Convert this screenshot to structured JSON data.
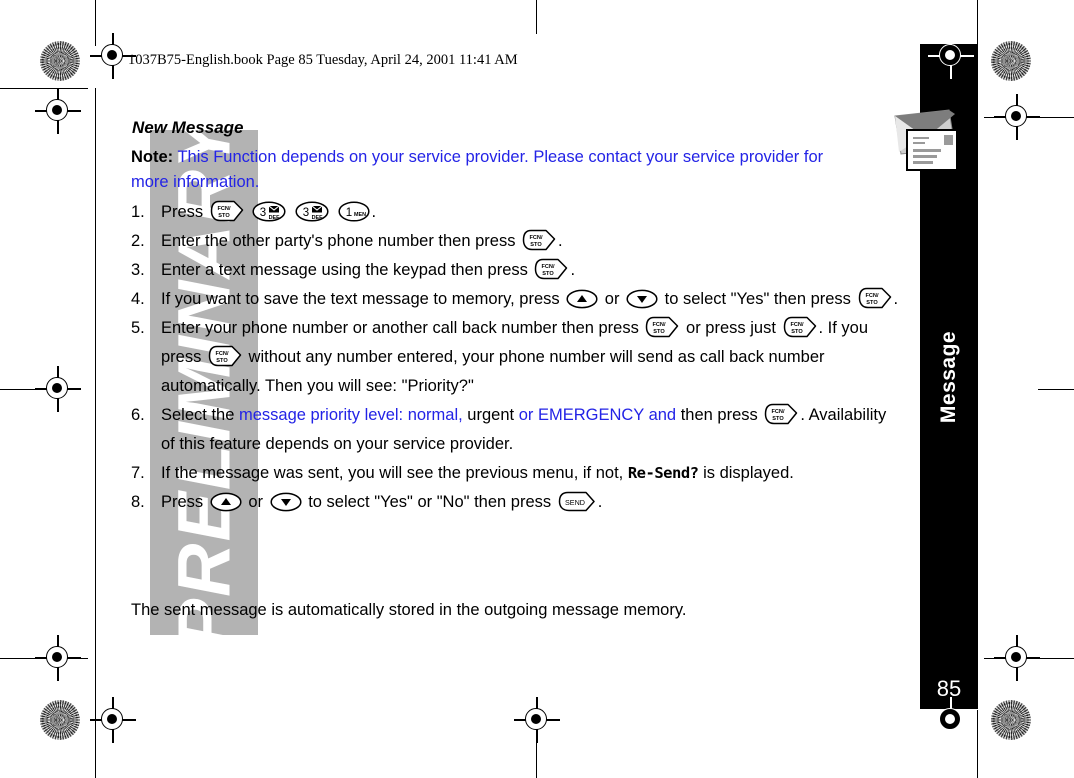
{
  "document": {
    "book_header": "1037B75-English.book  Page 85  Tuesday, April 24, 2001  11:41 AM",
    "watermark": "PRELIMINARY",
    "page_number": "85",
    "chapter_tab": "Message"
  },
  "icons": {
    "envelope": "envelope-icon",
    "fcn_sto_key": "fcn-sto-key-icon",
    "key_3def": "keypad-3-def-icon",
    "key_1men": "keypad-1-men-icon",
    "up_key": "scroll-up-key-icon",
    "down_key": "scroll-down-key-icon",
    "send_key": "send-key-icon",
    "registration_target": "registration-target-icon",
    "registration_starburst": "registration-starburst-icon"
  },
  "keys": {
    "fcn_line1": "FCN/",
    "fcn_line2": "STO",
    "three": "3",
    "def": "DEF",
    "one": "1",
    "men": "MEN",
    "send": "SEND"
  },
  "section": {
    "heading": "New Message",
    "note_label": "Note:",
    "note_text": "This Function depends on your service provider. Please contact your service provider for more information."
  },
  "steps": [
    {
      "num": "1.",
      "parts": [
        {
          "t": "Press ",
          "c": "black"
        },
        {
          "t": "[FCN/STO]",
          "c": "key-fcn"
        },
        {
          "t": " ",
          "c": "black"
        },
        {
          "t": "[3DEF]",
          "c": "key-3"
        },
        {
          "t": " ",
          "c": "black"
        },
        {
          "t": "[3DEF]",
          "c": "key-3"
        },
        {
          "t": " ",
          "c": "black"
        },
        {
          "t": "[1MEN]",
          "c": "key-1"
        },
        {
          "t": ".",
          "c": "black"
        }
      ]
    },
    {
      "num": "2.",
      "parts": [
        {
          "t": "Enter the other party's phone number then press ",
          "c": "black"
        },
        {
          "t": "[FCN/STO]",
          "c": "key-fcn"
        },
        {
          "t": ".",
          "c": "black"
        }
      ]
    },
    {
      "num": "3.",
      "parts": [
        {
          "t": "Enter a text message using the keypad then press ",
          "c": "black"
        },
        {
          "t": "[FCN/STO]",
          "c": "key-fcn"
        },
        {
          "t": ".",
          "c": "black"
        }
      ]
    },
    {
      "num": "4.",
      "parts": [
        {
          "t": "If you want to save the text message to memory, press ",
          "c": "black"
        },
        {
          "t": "[UP]",
          "c": "key-up"
        },
        {
          "t": " or ",
          "c": "black"
        },
        {
          "t": "[DOWN]",
          "c": "key-down"
        },
        {
          "t": " to select \"Yes\" then press ",
          "c": "black"
        },
        {
          "t": "[FCN/STO]",
          "c": "key-fcn"
        },
        {
          "t": ".",
          "c": "black"
        }
      ]
    },
    {
      "num": "5.",
      "parts": [
        {
          "t": "Enter your phone number or another call back number then press ",
          "c": "black"
        },
        {
          "t": "[FCN/STO]",
          "c": "key-fcn"
        },
        {
          "t": " or press just ",
          "c": "black"
        },
        {
          "t": "[FCN/STO]",
          "c": "key-fcn"
        },
        {
          "t": ". If you press ",
          "c": "black"
        },
        {
          "t": "[FCN/STO]",
          "c": "key-fcn"
        },
        {
          "t": " without any number entered, your phone number will send as call back number automatically. Then you will see: \"Priority?\"",
          "c": "black"
        }
      ]
    },
    {
      "num": "6.",
      "parts": [
        {
          "t": "Select the ",
          "c": "black"
        },
        {
          "t": "message priority level: normal,",
          "c": "blue"
        },
        {
          "t": " urgent ",
          "c": "black"
        },
        {
          "t": "or EMERGENCY and",
          "c": "blue"
        },
        {
          "t": " then press ",
          "c": "black"
        },
        {
          "t": "[FCN/STO]",
          "c": "key-fcn"
        },
        {
          "t": ". Availability of this feature depends on your service provider.",
          "c": "black"
        }
      ]
    },
    {
      "num": "7.",
      "parts": [
        {
          "t": "If the message was sent, you will see the previous menu, if not, ",
          "c": "black"
        },
        {
          "t": "Re-Send?",
          "c": "lcd"
        },
        {
          "t": " is displayed.",
          "c": "black"
        }
      ]
    },
    {
      "num": "8.",
      "parts": [
        {
          "t": "Press ",
          "c": "black"
        },
        {
          "t": "[UP]",
          "c": "key-up"
        },
        {
          "t": " or ",
          "c": "black"
        },
        {
          "t": "[DOWN]",
          "c": "key-down"
        },
        {
          "t": " to select \"Yes\" or \"No\" then press ",
          "c": "black"
        },
        {
          "t": "[SEND]",
          "c": "key-send"
        },
        {
          "t": ".",
          "c": "black"
        }
      ]
    }
  ],
  "closing_text": "The sent message is automatically stored in the outgoing message memory.",
  "colors": {
    "link_blue": "#2323e6",
    "sidebar_black": "#000000",
    "watermark_gray": "#b3b3b3",
    "page_white": "#ffffff"
  }
}
